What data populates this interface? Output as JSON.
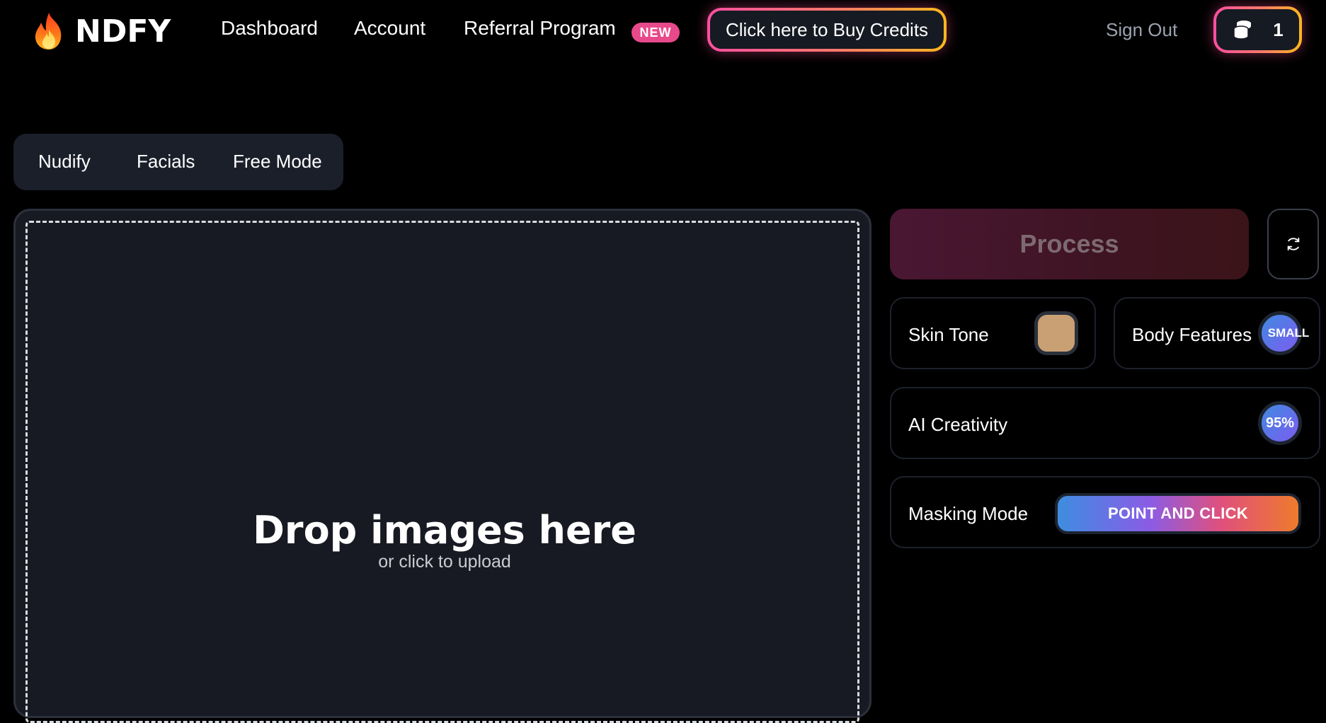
{
  "header": {
    "logo_text": "NDFY",
    "logo_icon": "fire-icon",
    "nav": {
      "dashboard": "Dashboard",
      "account": "Account",
      "referral": "Referral Program",
      "new_badge": "NEW"
    },
    "buy_credits": "Click here to Buy Credits",
    "sign_out": "Sign Out",
    "credits_count": "1",
    "credits_icon": "coins-icon",
    "accent_gradient": [
      "#ff4fa0",
      "#ffb81c"
    ]
  },
  "tabs": [
    "Nudify",
    "Facials",
    "Free Mode"
  ],
  "dropzone": {
    "title": "Drop images here",
    "subtitle": "or click to upload"
  },
  "panel": {
    "process_label": "Process",
    "refresh_icon": "refresh-icon",
    "skin_tone": {
      "label": "Skin Tone",
      "color": "#c9a074"
    },
    "body_features": {
      "label": "Body Features",
      "value": "SMALL"
    },
    "ai_creativity": {
      "label": "AI Creativity",
      "value": "95%"
    },
    "masking_mode": {
      "label": "Masking Mode",
      "value": "POINT AND CLICK"
    }
  }
}
